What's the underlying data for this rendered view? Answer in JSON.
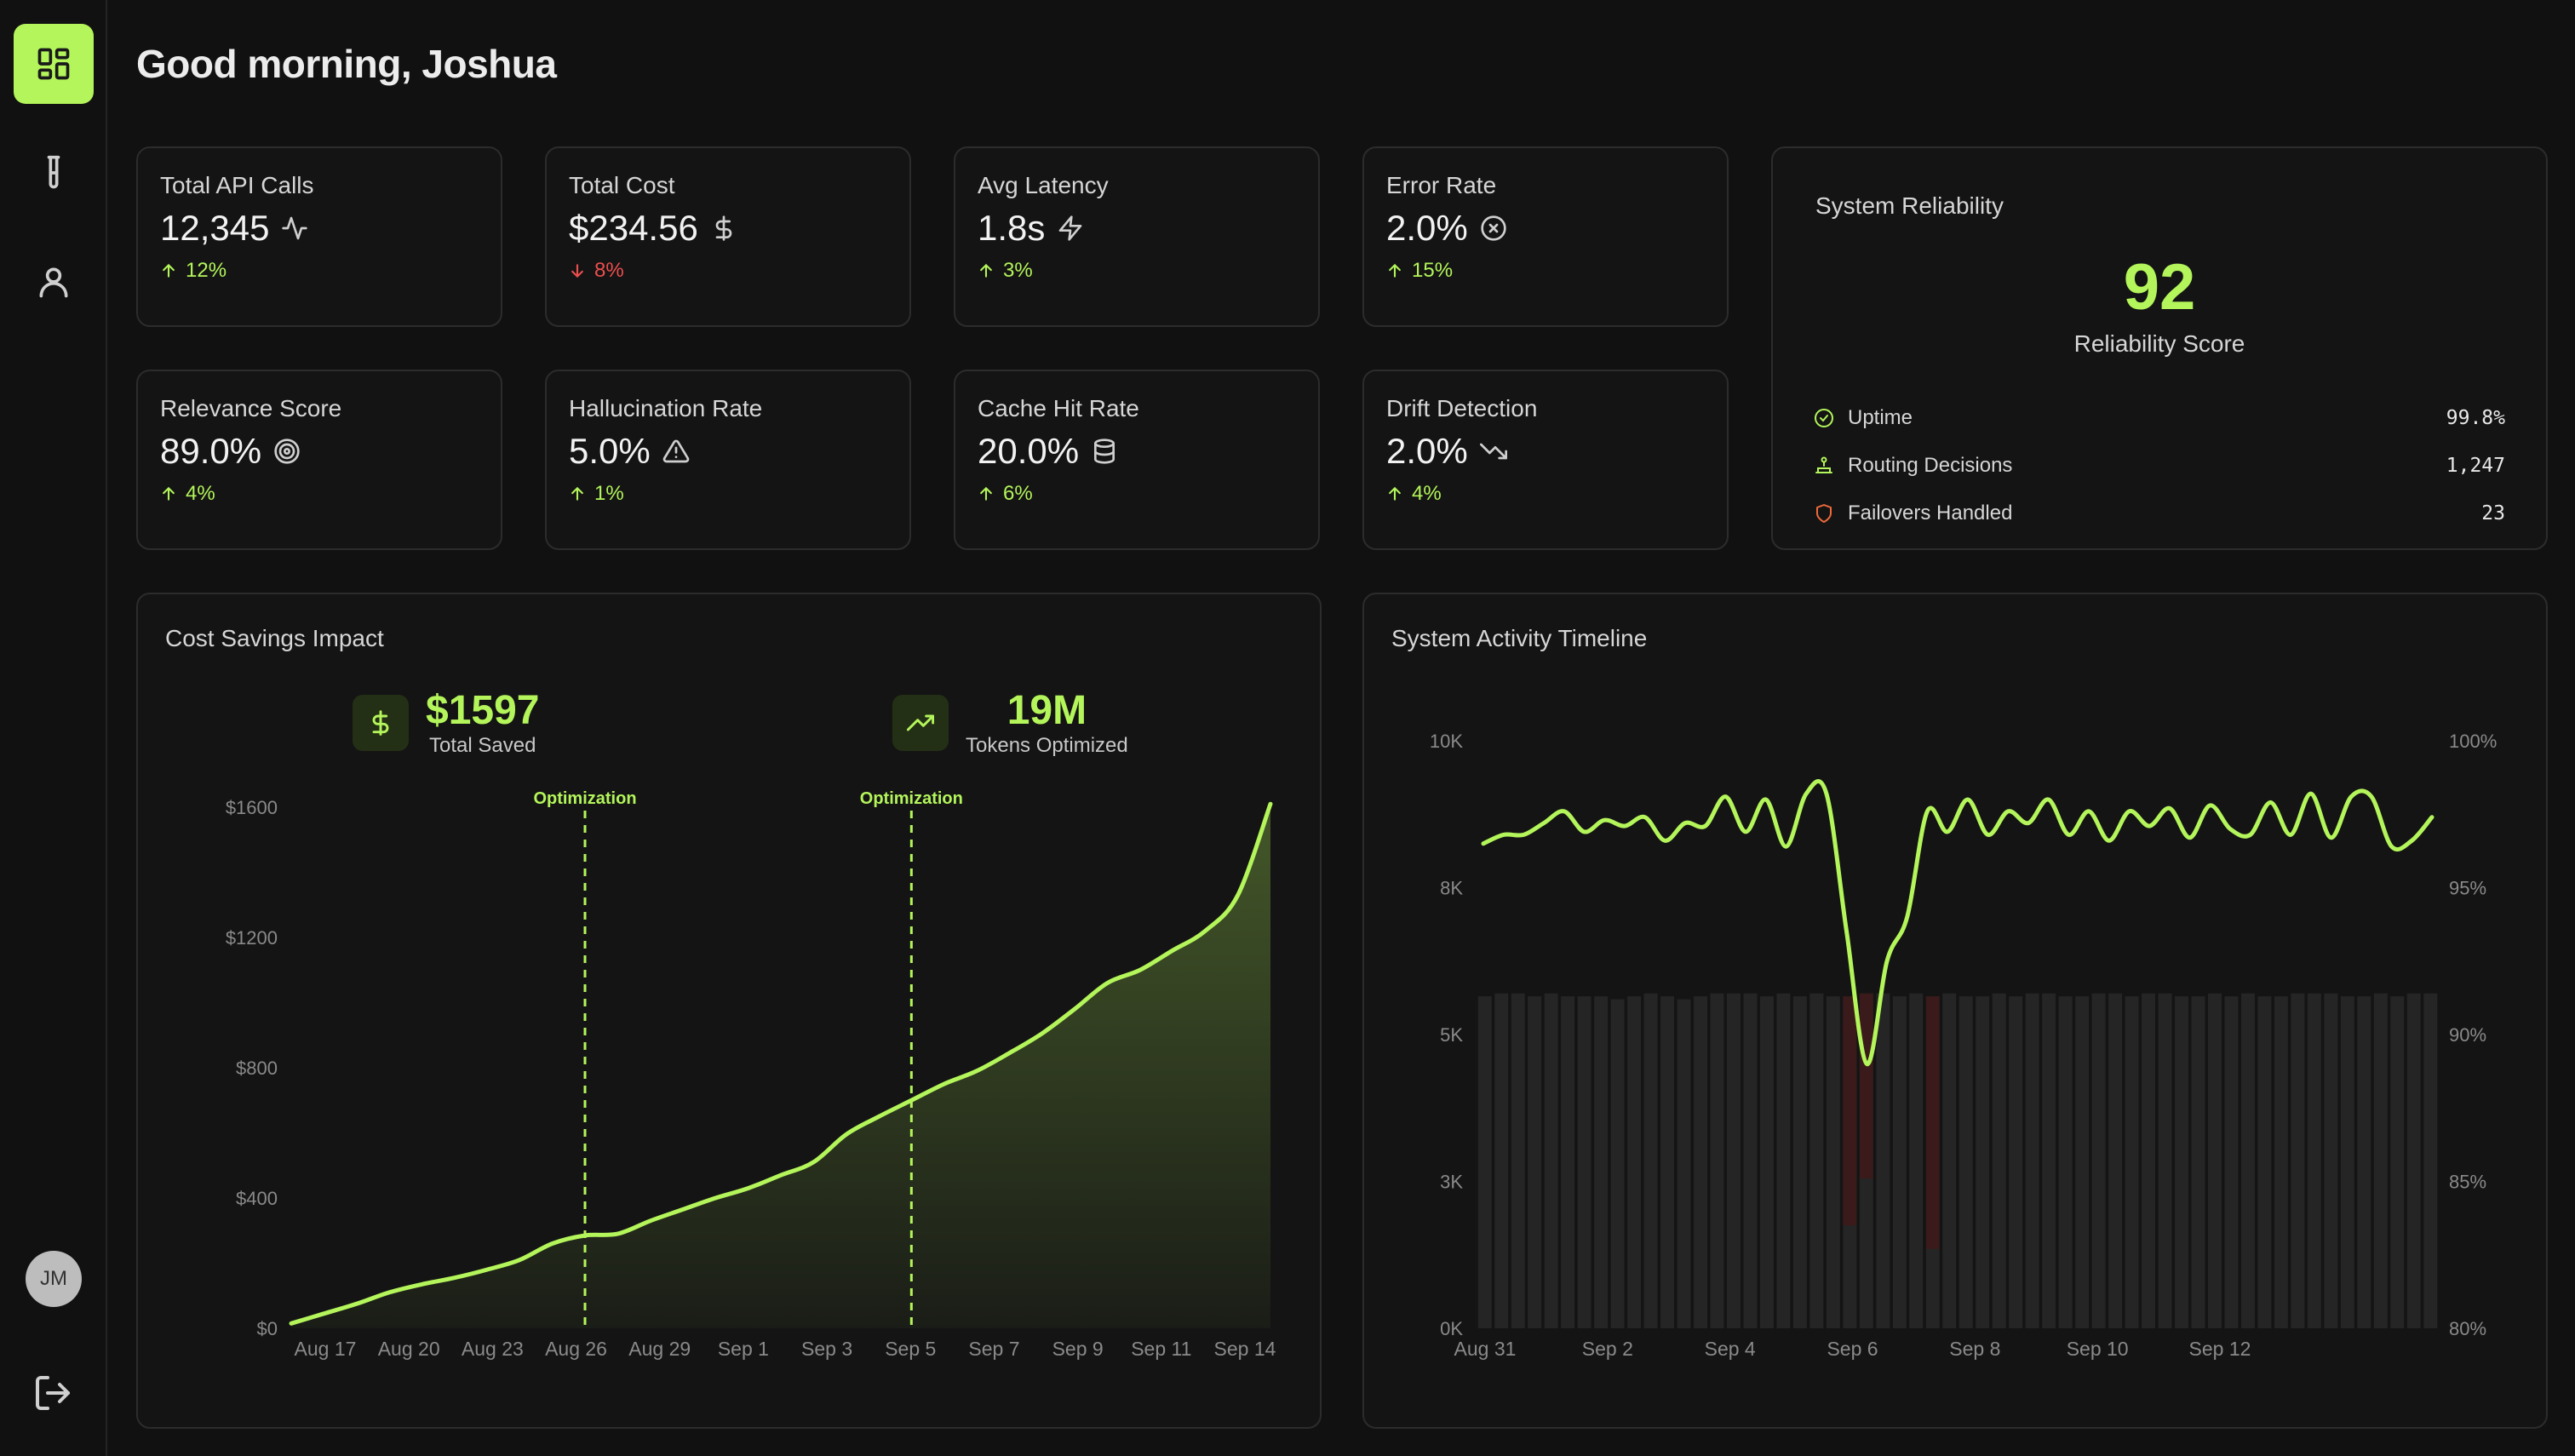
{
  "header": {
    "greeting": "Good morning, Joshua"
  },
  "sidebar": {
    "items": [
      {
        "name": "dashboard",
        "icon": "dashboard-grid-icon",
        "active": true
      },
      {
        "name": "experiments",
        "icon": "test-tube-icon",
        "active": false
      },
      {
        "name": "profile",
        "icon": "user-icon",
        "active": false
      }
    ],
    "avatar_initials": "JM",
    "logout_icon": "logout-icon"
  },
  "metrics": [
    {
      "label": "Total API Calls",
      "value": "12,345",
      "icon": "activity-icon",
      "change": "12%",
      "direction": "up"
    },
    {
      "label": "Total Cost",
      "value": "$234.56",
      "icon": "dollar-icon",
      "change": "8%",
      "direction": "down"
    },
    {
      "label": "Avg Latency",
      "value": "1.8s",
      "icon": "zap-icon",
      "change": "3%",
      "direction": "up"
    },
    {
      "label": "Error Rate",
      "value": "2.0%",
      "icon": "x-circle-icon",
      "change": "15%",
      "direction": "up"
    },
    {
      "label": "Relevance Score",
      "value": "89.0%",
      "icon": "target-icon",
      "change": "4%",
      "direction": "up"
    },
    {
      "label": "Hallucination Rate",
      "value": "5.0%",
      "icon": "alert-triangle-icon",
      "change": "1%",
      "direction": "up"
    },
    {
      "label": "Cache Hit Rate",
      "value": "20.0%",
      "icon": "database-icon",
      "change": "6%",
      "direction": "up"
    },
    {
      "label": "Drift Detection",
      "value": "2.0%",
      "icon": "trending-down-icon",
      "change": "4%",
      "direction": "up"
    }
  ],
  "reliability": {
    "title": "System Reliability",
    "score": "92",
    "score_label": "Reliability Score",
    "rows": [
      {
        "label": "Uptime",
        "value": "99.8%",
        "icon": "check-circle-icon",
        "color": "#b3f55a"
      },
      {
        "label": "Routing Decisions",
        "value": "1,247",
        "icon": "route-icon",
        "color": "#b3f55a"
      },
      {
        "label": "Failovers Handled",
        "value": "23",
        "icon": "shield-icon",
        "color": "#f06a3a"
      }
    ]
  },
  "cost_panel": {
    "title": "Cost Savings Impact",
    "kpis": [
      {
        "value": "$1597",
        "label": "Total Saved",
        "icon": "dollar-icon"
      },
      {
        "value": "19M",
        "label": "Tokens Optimized",
        "icon": "trending-up-icon"
      }
    ]
  },
  "activity_panel": {
    "title": "System Activity Timeline"
  },
  "colors": {
    "accent": "#b3f55a",
    "danger": "#ef4e4e",
    "background": "#111111",
    "card": "#141414"
  },
  "chart_data": [
    {
      "type": "area",
      "title": "Cost Savings Impact",
      "x_ticks": [
        "Aug 17",
        "Aug 20",
        "Aug 23",
        "Aug 26",
        "Aug 29",
        "Sep 1",
        "Sep 3",
        "Sep 5",
        "Sep 7",
        "Sep 9",
        "Sep 11",
        "Sep 14"
      ],
      "y_ticks": [
        "$0",
        "$400",
        "$800",
        "$1200",
        "$1600"
      ],
      "ylim": [
        0,
        1600
      ],
      "annotations": [
        {
          "label": "Optimization",
          "x_index": 9
        },
        {
          "label": "Optimization",
          "x_index": 19
        }
      ],
      "series": [
        {
          "values": [
            15,
            45,
            75,
            110,
            135,
            155,
            180,
            210,
            260,
            285,
            290,
            330,
            365,
            400,
            430,
            470,
            510,
            595,
            650,
            700,
            750,
            790,
            845,
            905,
            980,
            1060,
            1100,
            1160,
            1220,
            1330,
            1610
          ]
        }
      ]
    },
    {
      "type": "bar+line",
      "title": "System Activity Timeline",
      "x_ticks": [
        "Aug 31",
        "Sep 2",
        "Sep 4",
        "Sep 6",
        "Sep 8",
        "Sep 10",
        "Sep 12"
      ],
      "y_left_ticks": [
        "0K",
        "3K",
        "5K",
        "8K",
        "10K"
      ],
      "y_right_ticks": [
        "80%",
        "85%",
        "90%",
        "95%",
        "100%"
      ],
      "ylim_left": [
        0,
        10000
      ],
      "ylim_right": [
        80,
        100
      ],
      "bars": {
        "values": [
          5650,
          5700,
          5700,
          5650,
          5700,
          5650,
          5650,
          5650,
          5600,
          5650,
          5700,
          5650,
          5600,
          5650,
          5700,
          5700,
          5700,
          5650,
          5700,
          5650,
          5700,
          5650,
          5650,
          5700,
          5700,
          5650,
          5700,
          5650,
          5700,
          5650,
          5650,
          5700,
          5650,
          5700,
          5700,
          5650,
          5650,
          5700,
          5700,
          5650,
          5700,
          5700,
          5650,
          5650,
          5700,
          5650,
          5700,
          5650,
          5650,
          5700,
          5700,
          5700,
          5650,
          5650,
          5700,
          5650,
          5700,
          5700
        ],
        "error_values": [
          0,
          0,
          0,
          0,
          0,
          0,
          0,
          0,
          0,
          0,
          0,
          0,
          0,
          0,
          0,
          0,
          0,
          0,
          0,
          0,
          0,
          0,
          3900,
          3150,
          0,
          0,
          0,
          4300,
          0,
          0,
          0,
          0,
          0,
          0,
          0,
          0,
          0,
          0,
          0,
          0,
          0,
          0,
          0,
          0,
          0,
          0,
          0,
          0,
          0,
          0,
          0,
          0,
          0,
          0,
          0,
          0,
          0,
          0
        ]
      },
      "line": {
        "values": [
          96.5,
          96.8,
          96.8,
          97.2,
          97.6,
          96.9,
          97.3,
          97.1,
          97.4,
          96.6,
          97.2,
          97.1,
          98.1,
          96.9,
          98.0,
          96.4,
          98.2,
          98.2,
          93.5,
          89.0,
          92.5,
          94.0,
          97.6,
          96.9,
          98.0,
          96.8,
          97.6,
          97.2,
          98.0,
          96.8,
          97.6,
          96.6,
          97.6,
          97.1,
          97.7,
          96.7,
          97.8,
          97.0,
          96.8,
          97.9,
          96.8,
          98.2,
          96.7,
          98.1,
          98.1,
          96.4,
          96.6,
          97.4
        ]
      }
    }
  ]
}
